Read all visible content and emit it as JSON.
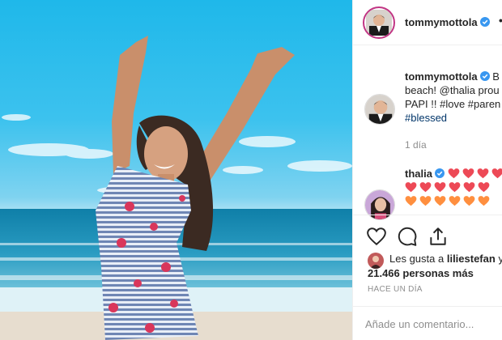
{
  "post": {
    "author": "tommymottola",
    "more_glyph": "•",
    "caption": {
      "username": "tommymottola",
      "lines": [
        "B",
        "beach! @thalia prou",
        "PAPI !! #love #paren",
        "#blessed"
      ]
    },
    "time_ago": "1 día"
  },
  "reply": {
    "username": "thalia",
    "hearts_line1": 5,
    "hearts_line2": 6,
    "hearts_line3": 6
  },
  "actions": {
    "like_icon": "heart-outline-icon",
    "comment_icon": "speech-bubble-icon",
    "share_icon": "share-upload-icon"
  },
  "likes": {
    "liked_by_prefix": "Les gusta a",
    "liked_by_user": "liliestefan",
    "liked_by_suffix": "y",
    "count": "21.466 personas más"
  },
  "date_label": "HACE UN DÍA",
  "comment_input": {
    "placeholder": "Añade un comentario..."
  },
  "colors": {
    "verified": "#3897f0",
    "heart_red": "#ed4956",
    "heart_orange": "#ff8f3f",
    "link": "#003569"
  }
}
